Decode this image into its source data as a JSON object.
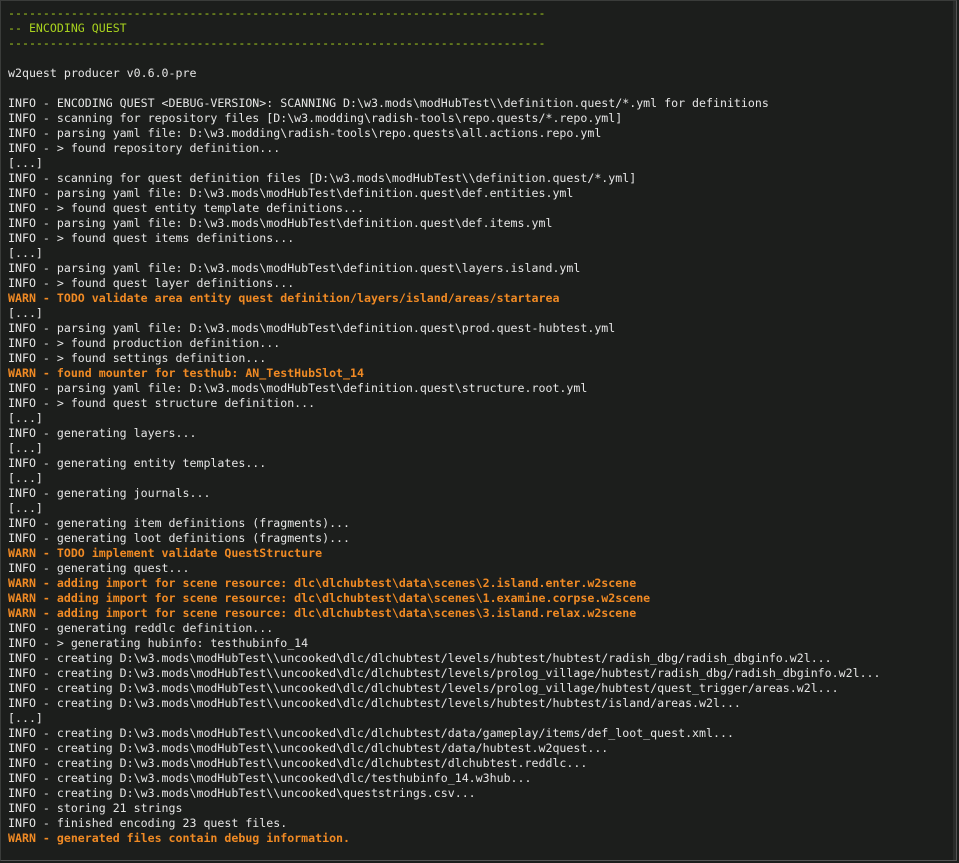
{
  "colors": {
    "background": "#1c1e1c",
    "info": "#e6e6e6",
    "header": "#a8d21e",
    "warn": "#f08a24"
  },
  "console": {
    "lines": [
      {
        "text": "-----------------------------------------------------------------------------",
        "type": "header"
      },
      {
        "text": "-- ENCODING QUEST",
        "type": "header"
      },
      {
        "text": "-----------------------------------------------------------------------------",
        "type": "header"
      },
      {
        "text": "",
        "type": "info"
      },
      {
        "text": "w2quest producer v0.6.0-pre",
        "type": "info"
      },
      {
        "text": "",
        "type": "info"
      },
      {
        "text": "INFO - ENCODING QUEST <DEBUG-VERSION>: SCANNING D:\\w3.mods\\modHubTest\\\\definition.quest/*.yml for definitions",
        "type": "info"
      },
      {
        "text": "INFO - scanning for repository files [D:\\w3.modding\\radish-tools\\repo.quests/*.repo.yml]",
        "type": "info"
      },
      {
        "text": "INFO - parsing yaml file: D:\\w3.modding\\radish-tools\\repo.quests\\all.actions.repo.yml",
        "type": "info"
      },
      {
        "text": "INFO - > found repository definition...",
        "type": "info"
      },
      {
        "text": "[...]",
        "type": "info"
      },
      {
        "text": "INFO - scanning for quest definition files [D:\\w3.mods\\modHubTest\\\\definition.quest/*.yml]",
        "type": "info"
      },
      {
        "text": "INFO - parsing yaml file: D:\\w3.mods\\modHubTest\\definition.quest\\def.entities.yml",
        "type": "info"
      },
      {
        "text": "INFO - > found quest entity template definitions...",
        "type": "info"
      },
      {
        "text": "INFO - parsing yaml file: D:\\w3.mods\\modHubTest\\definition.quest\\def.items.yml",
        "type": "info"
      },
      {
        "text": "INFO - > found quest items definitions...",
        "type": "info"
      },
      {
        "text": "[...]",
        "type": "info"
      },
      {
        "text": "INFO - parsing yaml file: D:\\w3.mods\\modHubTest\\definition.quest\\layers.island.yml",
        "type": "info"
      },
      {
        "text": "INFO - > found quest layer definitions...",
        "type": "info"
      },
      {
        "text": "WARN - TODO validate area entity quest definition/layers/island/areas/startarea",
        "type": "warn"
      },
      {
        "text": "[...]",
        "type": "info"
      },
      {
        "text": "INFO - parsing yaml file: D:\\w3.mods\\modHubTest\\definition.quest\\prod.quest-hubtest.yml",
        "type": "info"
      },
      {
        "text": "INFO - > found production definition...",
        "type": "info"
      },
      {
        "text": "INFO - > found settings definition...",
        "type": "info"
      },
      {
        "text": "WARN - found mounter for testhub: AN_TestHubSlot_14",
        "type": "warn"
      },
      {
        "text": "INFO - parsing yaml file: D:\\w3.mods\\modHubTest\\definition.quest\\structure.root.yml",
        "type": "info"
      },
      {
        "text": "INFO - > found quest structure definition...",
        "type": "info"
      },
      {
        "text": "[...]",
        "type": "info"
      },
      {
        "text": "INFO - generating layers...",
        "type": "info"
      },
      {
        "text": "[...]",
        "type": "info"
      },
      {
        "text": "INFO - generating entity templates...",
        "type": "info"
      },
      {
        "text": "[...]",
        "type": "info"
      },
      {
        "text": "INFO - generating journals...",
        "type": "info"
      },
      {
        "text": "[...]",
        "type": "info"
      },
      {
        "text": "INFO - generating item definitions (fragments)...",
        "type": "info"
      },
      {
        "text": "INFO - generating loot definitions (fragments)...",
        "type": "info"
      },
      {
        "text": "WARN - TODO implement validate QuestStructure",
        "type": "warn"
      },
      {
        "text": "INFO - generating quest...",
        "type": "info"
      },
      {
        "text": "WARN - adding import for scene resource: dlc\\dlchubtest\\data\\scenes\\2.island.enter.w2scene",
        "type": "warn"
      },
      {
        "text": "WARN - adding import for scene resource: dlc\\dlchubtest\\data\\scenes\\1.examine.corpse.w2scene",
        "type": "warn"
      },
      {
        "text": "WARN - adding import for scene resource: dlc\\dlchubtest\\data\\scenes\\3.island.relax.w2scene",
        "type": "warn"
      },
      {
        "text": "INFO - generating reddlc definition...",
        "type": "info"
      },
      {
        "text": "INFO - > generating hubinfo: testhubinfo_14",
        "type": "info"
      },
      {
        "text": "INFO - creating D:\\w3.mods\\modHubTest\\\\uncooked\\dlc/dlchubtest/levels/hubtest/hubtest/radish_dbg/radish_dbginfo.w2l...",
        "type": "info"
      },
      {
        "text": "INFO - creating D:\\w3.mods\\modHubTest\\\\uncooked\\dlc/dlchubtest/levels/prolog_village/hubtest/radish_dbg/radish_dbginfo.w2l...",
        "type": "info"
      },
      {
        "text": "INFO - creating D:\\w3.mods\\modHubTest\\\\uncooked\\dlc/dlchubtest/levels/prolog_village/hubtest/quest_trigger/areas.w2l...",
        "type": "info"
      },
      {
        "text": "INFO - creating D:\\w3.mods\\modHubTest\\\\uncooked\\dlc/dlchubtest/levels/hubtest/hubtest/island/areas.w2l...",
        "type": "info"
      },
      {
        "text": "[...]",
        "type": "info"
      },
      {
        "text": "INFO - creating D:\\w3.mods\\modHubTest\\\\uncooked\\dlc/dlchubtest/data/gameplay/items/def_loot_quest.xml...",
        "type": "info"
      },
      {
        "text": "INFO - creating D:\\w3.mods\\modHubTest\\\\uncooked\\dlc/dlchubtest/data/hubtest.w2quest...",
        "type": "info"
      },
      {
        "text": "INFO - creating D:\\w3.mods\\modHubTest\\\\uncooked\\dlc/dlchubtest/dlchubtest.reddlc...",
        "type": "info"
      },
      {
        "text": "INFO - creating D:\\w3.mods\\modHubTest\\\\uncooked\\dlc/testhubinfo_14.w3hub...",
        "type": "info"
      },
      {
        "text": "INFO - creating D:\\w3.mods\\modHubTest\\\\uncooked\\queststrings.csv...",
        "type": "info"
      },
      {
        "text": "INFO - storing 21 strings",
        "type": "info"
      },
      {
        "text": "INFO - finished encoding 23 quest files.",
        "type": "info"
      },
      {
        "text": "WARN - generated files contain debug information.",
        "type": "warn"
      }
    ]
  }
}
